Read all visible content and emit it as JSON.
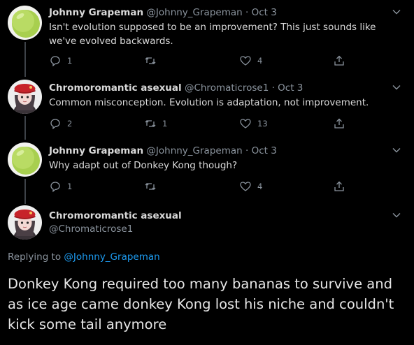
{
  "tweets": [
    {
      "name": "Johnny Grapeman",
      "handle": "@Johnny_Grapeman",
      "separator": "·",
      "date": "Oct 3",
      "text": "Isn't evolution supposed to be an improvement? This just sounds like we've evolved backwards.",
      "replies": "1",
      "retweets": "",
      "likes": "4",
      "avatar": "green-grape"
    },
    {
      "name": "Chromoromantic asexual",
      "handle": "@Chromaticrose1",
      "separator": "·",
      "date": "Oct 3",
      "text": "Common misconception. Evolution is adaptation, not improvement.",
      "replies": "2",
      "retweets": "1",
      "likes": "13",
      "avatar": "red-beret-girl"
    },
    {
      "name": "Johnny Grapeman",
      "handle": "@Johnny_Grapeman",
      "separator": "·",
      "date": "Oct 3",
      "text": "Why adapt out of Donkey Kong though?",
      "replies": "1",
      "retweets": "",
      "likes": "4",
      "avatar": "green-grape"
    }
  ],
  "main_tweet": {
    "name": "Chromoromantic asexual",
    "handle": "@Chromaticrose1",
    "replying_prefix": "Replying to",
    "replying_to": "@Johnny_Grapeman",
    "text": "Donkey Kong required too many bananas to survive and as ice age came donkey Kong lost his niche and couldn't kick some tail anymore"
  },
  "colors": {
    "background": "#000000",
    "accent": "#1d9bf0",
    "secondary_text": "#8b949e",
    "thread_line": "#3d4248"
  }
}
